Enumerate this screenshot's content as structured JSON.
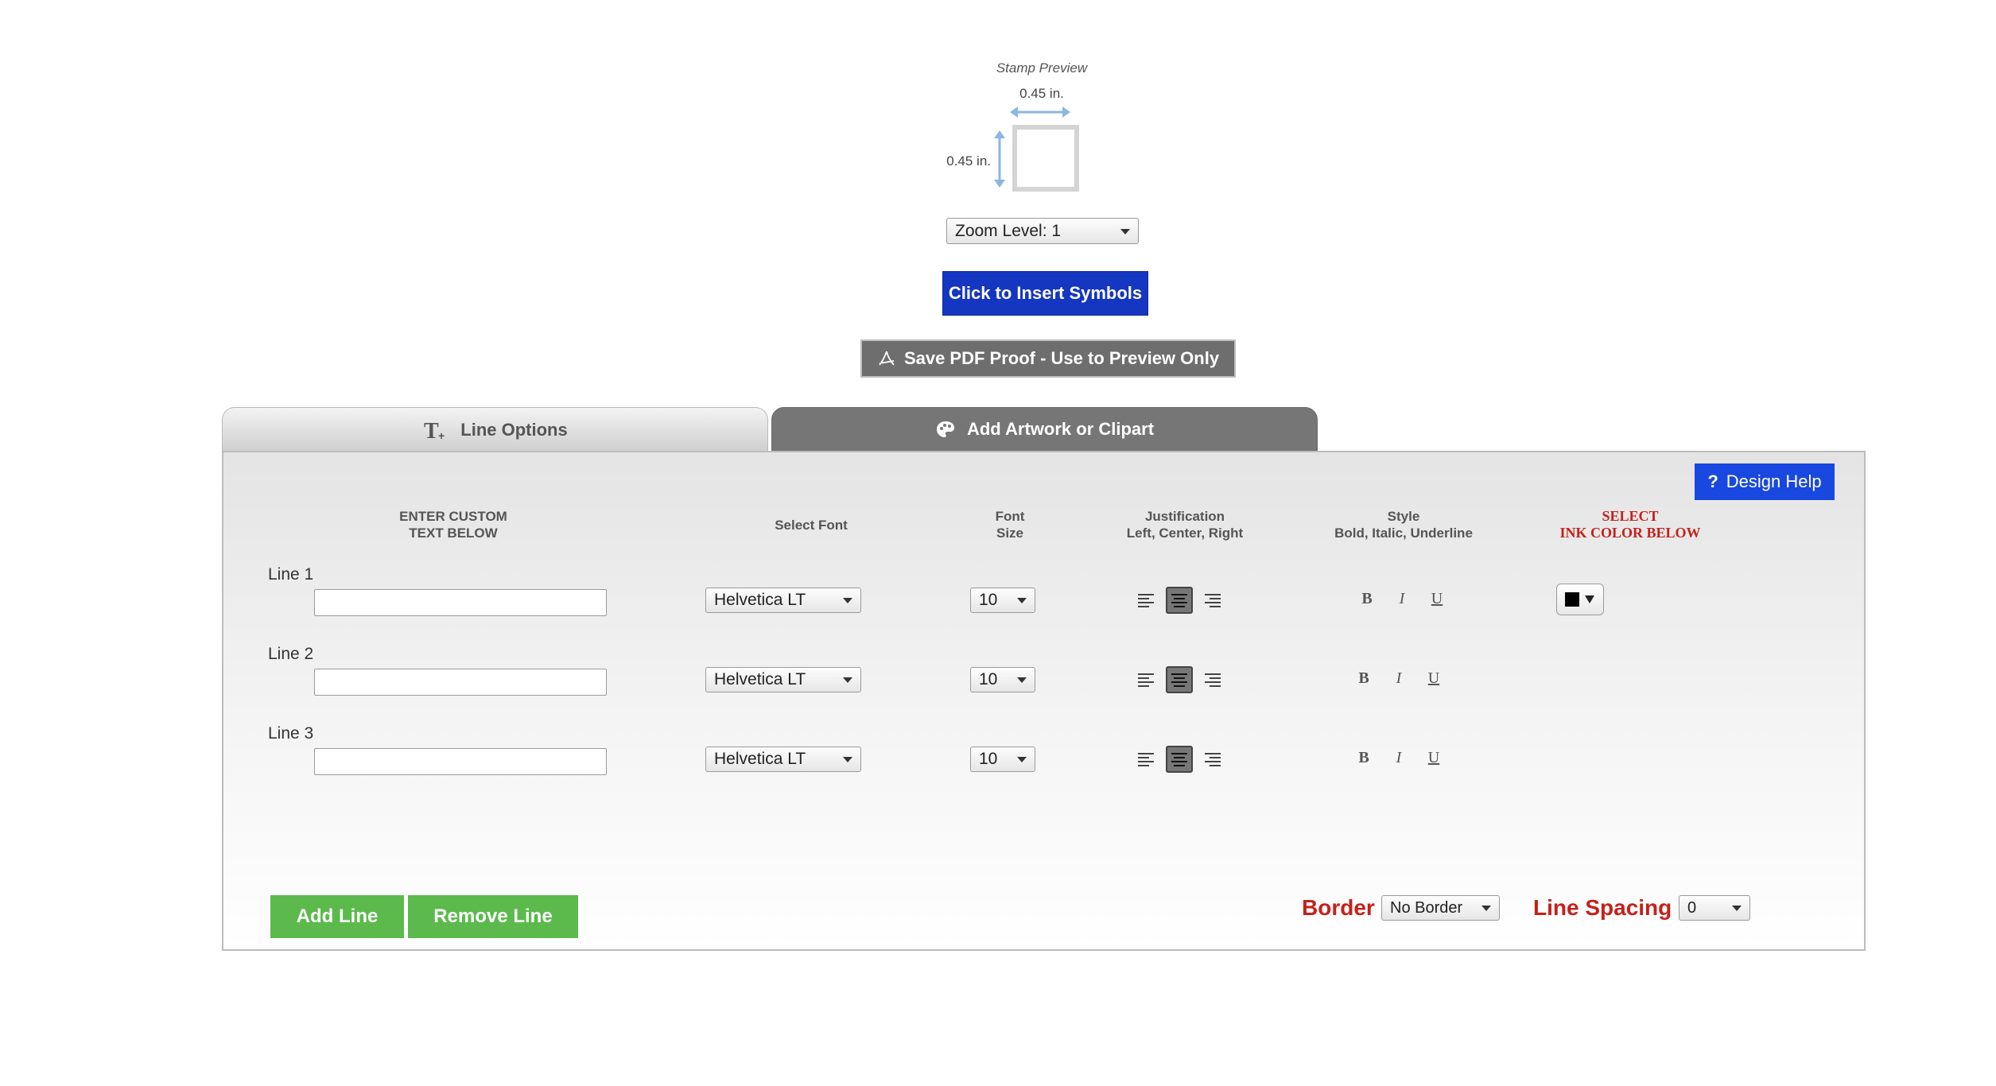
{
  "preview": {
    "title": "Stamp Preview",
    "width_label": "0.45 in.",
    "height_label": "0.45 in."
  },
  "zoom": {
    "value": "Zoom Level: 1"
  },
  "buttons": {
    "insert_symbols": "Click to Insert Symbols",
    "save_pdf": "Save PDF Proof - Use to Preview Only",
    "design_help": "Design Help",
    "add_line": "Add Line",
    "remove_line": "Remove Line"
  },
  "tabs": {
    "line_options": "Line Options",
    "artwork": "Add Artwork or Clipart"
  },
  "columns": {
    "text_1": "ENTER CUSTOM",
    "text_2": "TEXT BELOW",
    "font": "Select Font",
    "size_1": "Font",
    "size_2": "Size",
    "just_1": "Justification",
    "just_2": "Left, Center, Right",
    "style_1": "Style",
    "style_2": "Bold, Italic, Underline",
    "ink_1": "SELECT",
    "ink_2": "INK COLOR BELOW"
  },
  "lines": [
    {
      "label": "Line 1",
      "value": "",
      "font": "Helvetica LT",
      "size": "10"
    },
    {
      "label": "Line 2",
      "value": "",
      "font": "Helvetica LT",
      "size": "10"
    },
    {
      "label": "Line 3",
      "value": "",
      "font": "Helvetica LT",
      "size": "10"
    }
  ],
  "style_glyphs": {
    "bold": "B",
    "italic": "I",
    "underline": "U"
  },
  "footer": {
    "border_label": "Border",
    "border_value": "No Border",
    "spacing_label": "Line Spacing",
    "spacing_value": "0"
  },
  "colors": {
    "symbols_button": "#1536c1",
    "help_button": "#1848df",
    "green_button": "#5cba4d",
    "accent_red": "#c4211b",
    "ink_color": "#000000"
  }
}
